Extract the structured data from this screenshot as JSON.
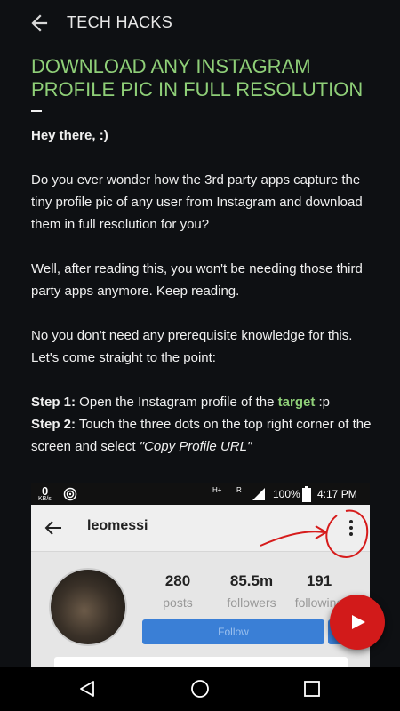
{
  "app_bar": {
    "title": "TECH HACKS"
  },
  "article": {
    "title": "DOWNLOAD ANY INSTAGRAM PROFILE PIC IN FULL RESOLUTION",
    "greeting": "Hey there, :)",
    "para1": "Do you ever wonder how the 3rd party apps capture the tiny profile pic of any user from Instagram and download them in full resolution for you?",
    "para2": "Well, after reading this, you won't be needing those third party apps anymore. Keep reading.",
    "para3": "No you don't need any prerequisite knowledge for this. Let's come straight to the point:",
    "step1_label": "Step 1:",
    "step1_text": " Open the Instagram profile of the ",
    "step1_link": "target",
    "step1_end": " :p",
    "step2_label": "Step 2:",
    "step2_text": " Touch the three dots on the top right corner of the screen and select ",
    "step2_quote": "\"Copy Profile URL\""
  },
  "screenshot": {
    "status": {
      "speed": "0",
      "speed_unit": "KB/s",
      "battery": "100%",
      "time": "4:17 PM",
      "net_h": "H+",
      "net_r": "R"
    },
    "username": "leomessi",
    "stats": [
      {
        "value": "280",
        "label": "posts"
      },
      {
        "value": "85.5m",
        "label": "followers"
      },
      {
        "value": "191",
        "label": "following"
      }
    ],
    "follow_label": "Follow"
  },
  "colors": {
    "accent": "#8fcf78",
    "background": "#0e1013",
    "fab": "#d21a1a",
    "follow_button": "#3a7fd6"
  }
}
